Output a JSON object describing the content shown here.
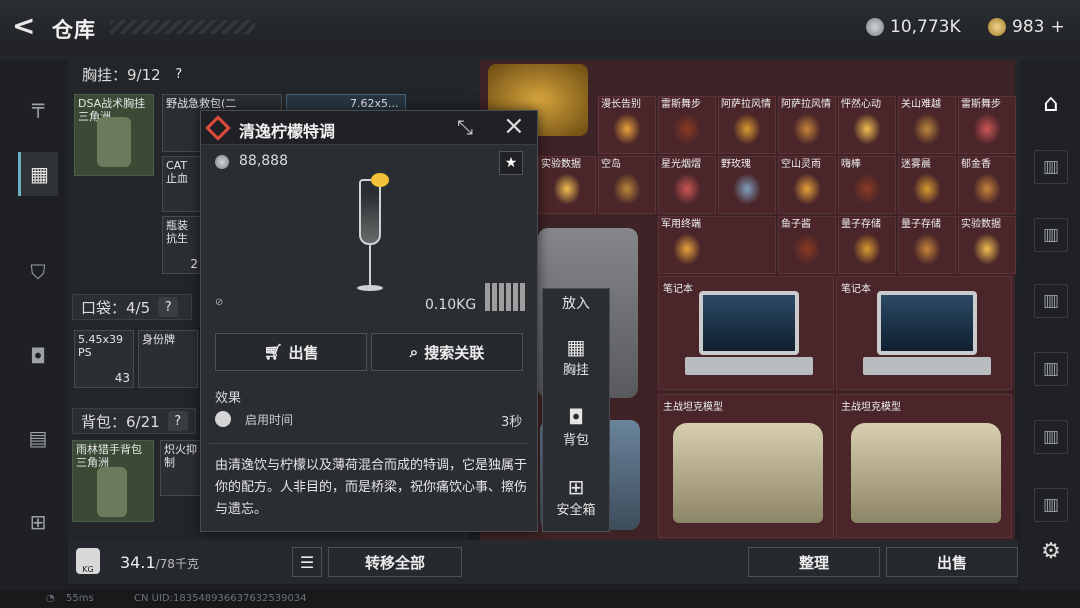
{
  "header": {
    "title": "仓库",
    "currency1": "10,773K",
    "currency2": "983",
    "currency2_plus": "+"
  },
  "equipment": {
    "chest_rig_label": "胸挂：9/12",
    "chest_rig_q": "?",
    "chest_rig_item": "DSA战术胸挂 三角洲",
    "chest_slot1": "野战急救包(二",
    "chest_slot2": "7.62x5...",
    "chest_slot3": "CAT止血",
    "chest_slot4": "瓶装抗生",
    "chest_slot4_count": "2",
    "pocket_label": "口袋：4/5",
    "pocket_q": "?",
    "pocket_item1": "5.45x39 PS",
    "pocket_item1_count": "43",
    "pocket_item2": "身份牌",
    "backpack_label": "背包：6/21",
    "backpack_q": "?",
    "backpack_item": "雨林猎手背包 三角洲",
    "backpack_slot2": "炽火抑制"
  },
  "popup": {
    "title": "清逸柠檬特调",
    "price": "88,888",
    "weight": "0.10KG",
    "sell_label": "出售",
    "search_label": "搜索关联",
    "effect_title": "效果",
    "effect_name": "启用时间",
    "effect_value": "3秒",
    "description": "由清逸饮与柠檬以及薄荷混合而成的特调，它是独属于你的配方。人非目的，而是桥梁，祝你痛饮心事、擦伤与遗忘。"
  },
  "actions": {
    "put_in": "放入",
    "chest": "胸挂",
    "backpack": "背包",
    "safebox": "安全箱"
  },
  "grid": {
    "row1": [
      "漫长告别",
      "雷斯舞步",
      "阿萨拉风情",
      "阿萨拉风情",
      "怦然心动",
      "关山难越",
      "雷斯舞步"
    ],
    "row2": [
      "实验数据",
      "空岛",
      "星光烟熠",
      "野玫瑰",
      "空山灵雨",
      "嗨棒",
      "迷雾晨",
      "郁金香"
    ],
    "row3": [
      "军用终端",
      "鱼子酱",
      "量子存储",
      "量子存储",
      "实验数据"
    ],
    "laptop1": "笔记本",
    "laptop2": "笔记本",
    "tank1": "主战坦克模型",
    "tank2": "主战坦克模型"
  },
  "bottom": {
    "weight": "34.1",
    "weight_max": "/78千克",
    "transfer_all": "转移全部",
    "organize": "整理",
    "sell": "出售"
  },
  "status": {
    "ping": "55ms",
    "uid": "CN UID:18354893663763253903​4"
  }
}
